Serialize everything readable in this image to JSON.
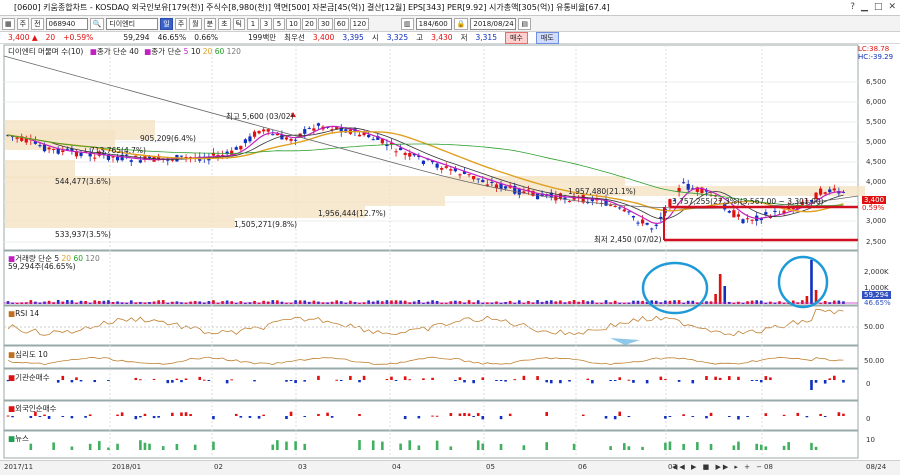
{
  "window": {
    "title": "[0600] 키움종합차트 - KOSDAQ 외국인보유[179(천)] 주식수[8,980(천)] 액면[500] 자본금[45(억)] 결산[12월] EPS[343] PER[9.92] 시가총액[305(억)] 유통비율[67.4]"
  },
  "toolbar": {
    "type_label": "주",
    "search_label": "전",
    "code": "068940",
    "name": "디이엔티",
    "day_label": "일",
    "week_label": "주",
    "month_label": "월",
    "year_label": "분",
    "tick_label": "초",
    "tick2_label": "틱",
    "intervals": [
      "1",
      "3",
      "5",
      "10",
      "20",
      "30",
      "60",
      "120"
    ],
    "count": "184/600",
    "date": "2018/08/24"
  },
  "quote": {
    "price": "3,400",
    "change_arrow": "▲",
    "change": "20",
    "change_pct": "+0.59%",
    "volume": "59,294",
    "turnover": "46.65%",
    "vol_ratio": "0.66%",
    "amount": "199백만",
    "prior_label": "최우선",
    "prior": "3,400",
    "ask": "3,395",
    "open_label": "시",
    "open": "3,325",
    "high_label": "고",
    "high": "3,430",
    "low_label": "저",
    "low": "3,315",
    "buy_label": "매수",
    "sell_label": "매도"
  },
  "price_panel": {
    "legend_name": "디이엔티 머물며 수(10)",
    "legend_ma": "종가 단순 40",
    "ma_periods": [
      "5",
      "10",
      "20",
      "60",
      "120"
    ],
    "ma_label": "종가 단순",
    "lc": "LC:38.78",
    "hc": "HC:-39.29",
    "y_ticks": [
      "6,500",
      "6,000",
      "5,500",
      "5,000",
      "4,500",
      "4,000",
      "3,500",
      "3,000",
      "2,500"
    ],
    "current_price": "3,400",
    "current_pct": "0.59%",
    "high_annotation": "최고 5,600 (03/02)",
    "low_annotation": "최저 2,450 (07/02)",
    "volume_profile": [
      "905,209(6.4%)",
      "713,765(4.7%)",
      "544,477(3.6%)",
      "1,957,480(21.1%)",
      "1,956,444(12.7%)",
      "1,505,271(9.8%)",
      "533,937(3.5%)",
      "3,757,255(27.3%)(3,567.00 ~ 3,301.00)"
    ]
  },
  "volume_panel": {
    "title": "거래량 단순 5",
    "periods": [
      "20",
      "60",
      "120"
    ],
    "value": "59,294주(46.65%)",
    "y_ticks": [
      "2,000K",
      "1,000K"
    ],
    "current": "59,294",
    "current_pct": "46.65%"
  },
  "rsi_panel": {
    "title": "RSI 14",
    "y_tick": "50.00"
  },
  "psy_panel": {
    "title": "심리도 10",
    "y_tick": "50.00"
  },
  "inst_panel": {
    "title": "기관순매수",
    "y_tick": "0"
  },
  "foreign_panel": {
    "title": "외국인순매수",
    "y_tick": "0"
  },
  "news_panel": {
    "title": "뉴스",
    "y_tick": "10"
  },
  "x_axis": [
    "2017/11",
    "2018/01",
    "02",
    "03",
    "04",
    "05",
    "06",
    "07",
    "08",
    "08/24"
  ],
  "colors": {
    "up": "#e01010",
    "down": "#1030c0",
    "ma5": "#c020c0",
    "ma20": "#e0a020",
    "circle": "#1e9ad6",
    "support": "#d01020"
  }
}
